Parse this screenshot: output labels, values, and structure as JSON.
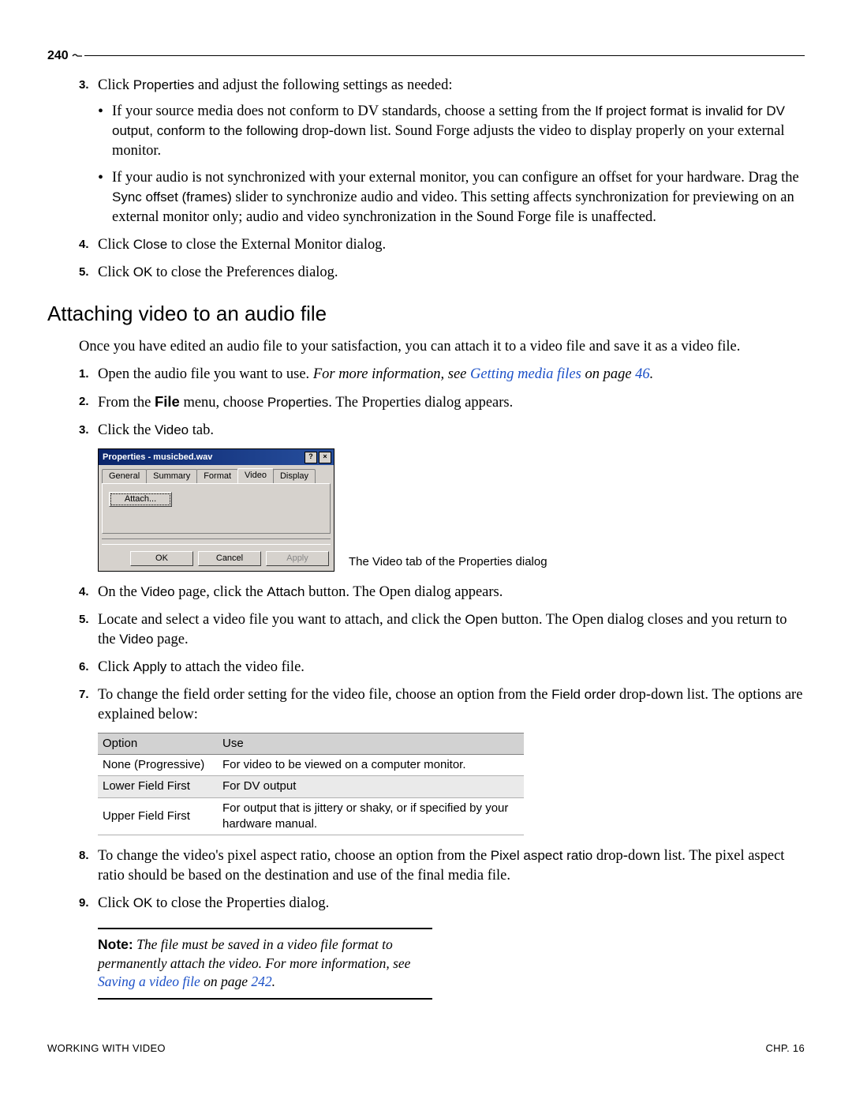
{
  "page_number": "240",
  "section_top": {
    "step3": {
      "num": "3.",
      "prefix": "Click ",
      "ui1": "Properties",
      "suffix": " and adjust the following settings as needed:",
      "bullet1": {
        "p1": "If your source media does not conform to DV standards, choose a setting from the ",
        "ui1": "If project format is invalid for DV output, conform to the following",
        "p2": " drop-down list. Sound Forge adjusts the video to display properly on your external monitor."
      },
      "bullet2": {
        "p1": "If your audio is not synchronized with your external monitor, you can configure an offset for your hardware. Drag the ",
        "ui1": "Sync offset (frames)",
        "p2": " slider to synchronize audio and video. This setting affects synchronization for previewing on an external monitor only; audio and video synchronization in the Sound Forge file is unaffected."
      }
    },
    "step4": {
      "num": "4.",
      "p1": "Click ",
      "ui1": "Close",
      "p2": " to close the External Monitor dialog."
    },
    "step5": {
      "num": "5.",
      "p1": "Click ",
      "ui1": "OK",
      "p2": " to close the Preferences dialog."
    }
  },
  "heading": "Attaching video to an audio file",
  "intro": "Once you have edited an audio file to your satisfaction, you can attach it to a video file and save it as a video file.",
  "steps2": {
    "s1": {
      "num": "1.",
      "p1": "Open the audio file you want to use. ",
      "it": "For more information, see ",
      "link": "Getting media files",
      "it2": " on page ",
      "linkpg": "46",
      "it3": "."
    },
    "s2": {
      "num": "2.",
      "p1": "From the ",
      "b1": "File",
      "p2": " menu, choose ",
      "ui1": "Properties",
      "p3": ". The Properties dialog appears."
    },
    "s3": {
      "num": "3.",
      "p1": "Click the ",
      "ui1": "Video",
      "p2": " tab."
    },
    "s4": {
      "num": "4.",
      "p1": "On the ",
      "ui1": "Video",
      "p2": " page, click the ",
      "ui2": "Attach",
      "p3": " button. The Open dialog appears."
    },
    "s5": {
      "num": "5.",
      "p1": "Locate and select a video file you want to attach, and click the ",
      "ui1": "Open",
      "p2": " button. The Open dialog closes and you return to the ",
      "ui2": "Video",
      "p3": " page."
    },
    "s6": {
      "num": "6.",
      "p1": "Click ",
      "ui1": "Apply",
      "p2": " to attach the video file."
    },
    "s7": {
      "num": "7.",
      "p1": "To change the field order setting for the video file, choose an option from the ",
      "ui1": "Field order",
      "p2": " drop-down list. The options are explained below:"
    },
    "s8": {
      "num": "8.",
      "p1": "To change the video's pixel aspect ratio, choose an option from the ",
      "ui1": "Pixel aspect ratio",
      "p2": " drop-down list. The pixel aspect ratio should be based on the destination and use of the final media file."
    },
    "s9": {
      "num": "9.",
      "p1": "Click ",
      "ui1": "OK",
      "p2": " to close the Properties dialog."
    }
  },
  "dialog": {
    "title": "Properties - musicbed.wav",
    "help": "?",
    "close": "×",
    "tabs": {
      "general": "General",
      "summary": "Summary",
      "format": "Format",
      "video": "Video",
      "display": "Display"
    },
    "attach": "Attach...",
    "ok": "OK",
    "cancel": "Cancel",
    "apply": "Apply"
  },
  "caption": "The Video tab of the Properties dialog",
  "table": {
    "h1": "Option",
    "h2": "Use",
    "r1c1": "None (Progressive)",
    "r1c2": "For video to be viewed on a computer monitor.",
    "r2c1": "Lower Field First",
    "r2c2": "For DV output",
    "r3c1": "Upper Field First",
    "r3c2": "For output that is jittery or shaky, or if specified by your hardware manual."
  },
  "note": {
    "label": "Note:",
    "it1": " The file must be saved in a video file format to permanently attach the video. For more information, see ",
    "link": "Saving a video file",
    "it2": " on page ",
    "linkpg": "242",
    "it3": "."
  },
  "footer": {
    "left": "WORKING WITH VIDEO",
    "right": "CHP. 16"
  }
}
